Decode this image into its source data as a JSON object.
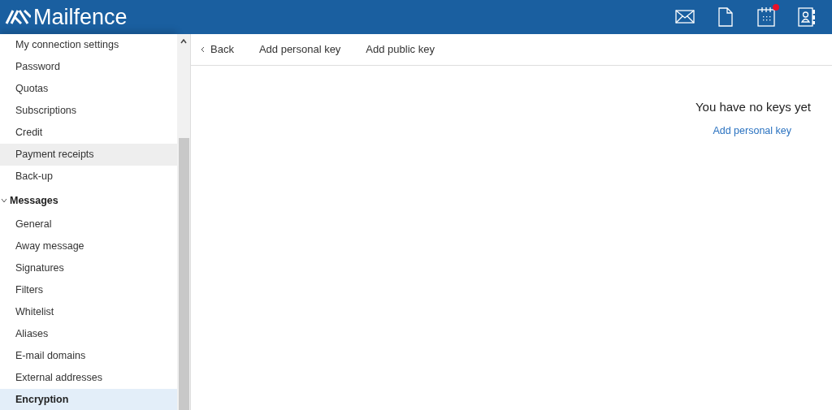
{
  "header": {
    "logo_text": "Mailfence",
    "icons": [
      {
        "kind": "mail"
      },
      {
        "kind": "document"
      },
      {
        "kind": "calendar",
        "notification": true
      },
      {
        "kind": "contacts"
      }
    ]
  },
  "sidebar": {
    "items": [
      {
        "label": "My connection settings",
        "selected": false,
        "hovered": false
      },
      {
        "label": "Password",
        "selected": false,
        "hovered": false
      },
      {
        "label": "Quotas",
        "selected": false,
        "hovered": false
      },
      {
        "label": "Subscriptions",
        "selected": false,
        "hovered": false
      },
      {
        "label": "Credit",
        "selected": false,
        "hovered": false
      },
      {
        "label": "Payment receipts",
        "selected": false,
        "hovered": true
      },
      {
        "label": "Back-up",
        "selected": false,
        "hovered": false
      },
      {
        "label": "Messages",
        "expanded": true,
        "children": [
          {
            "label": "General",
            "selected": false,
            "hovered": false
          },
          {
            "label": "Away message",
            "selected": false,
            "hovered": false
          },
          {
            "label": "Signatures",
            "selected": false,
            "hovered": false
          },
          {
            "label": "Filters",
            "selected": false,
            "hovered": false
          },
          {
            "label": "Whitelist",
            "selected": false,
            "hovered": false
          },
          {
            "label": "Aliases",
            "selected": false,
            "hovered": false
          },
          {
            "label": "E-mail domains",
            "selected": false,
            "hovered": false
          },
          {
            "label": "External addresses",
            "selected": false,
            "hovered": false
          },
          {
            "label": "Encryption",
            "selected": true,
            "hovered": false
          }
        ]
      }
    ]
  },
  "toolbar": {
    "back": "Back",
    "actions": [
      "Add personal key",
      "Add public key"
    ]
  },
  "empty_state": {
    "message": "You have no keys yet",
    "link": "Add personal key"
  }
}
